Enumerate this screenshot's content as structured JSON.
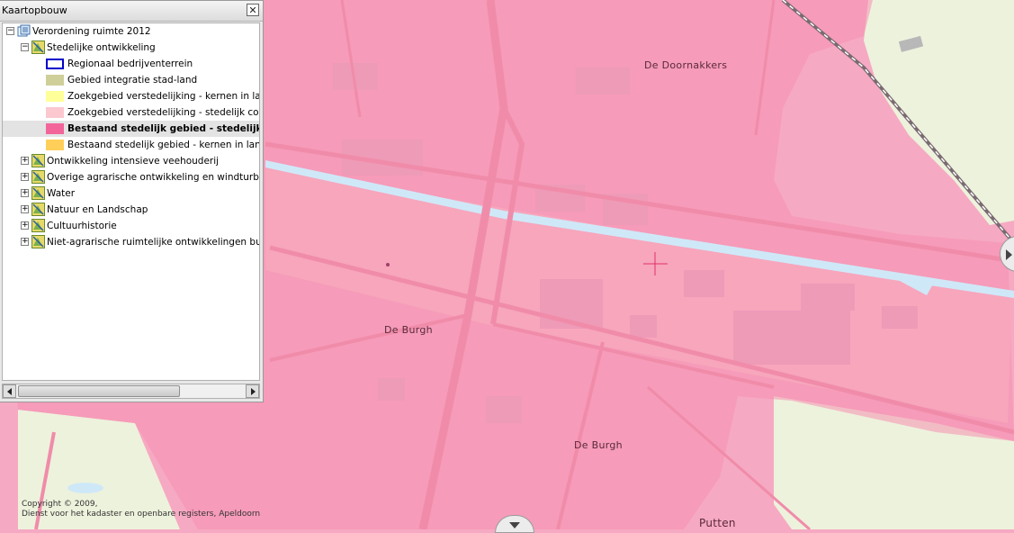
{
  "panel": {
    "title": "Kaartopbouw",
    "close_symbol": "✕",
    "root": {
      "label": "Verordening ruimte 2012",
      "toggle": "−"
    },
    "group": {
      "label": "Stedelijke ontwikkeling",
      "toggle": "−"
    },
    "legend_items": [
      {
        "label": "Regionaal bedrijventerrein",
        "fill": "#ffffff",
        "border": "#0000cc"
      },
      {
        "label": "Gebied integratie stad-land",
        "fill": "#cfcf9a",
        "border": "#cfcf9a"
      },
      {
        "label": "Zoekgebied verstedelijking - kernen in landelijk gebied",
        "fill": "#ffff99",
        "border": "#ffff99"
      },
      {
        "label": "Zoekgebied verstedelijking - stedelijk concentratiegebied",
        "fill": "#fbc8d0",
        "border": "#fbc8d0"
      },
      {
        "label": "Bestaand stedelijk gebied - stedelijk concentratiegebied",
        "fill": "#f2649a",
        "border": "#f2649a",
        "selected": true
      },
      {
        "label": "Bestaand stedelijk gebied - kernen in landelijk gebied",
        "fill": "#ffcf5a",
        "border": "#ffcf5a"
      }
    ],
    "collapsed_groups": [
      {
        "label": "Ontwikkeling intensieve veehouderij",
        "toggle": "+"
      },
      {
        "label": "Overige agrarische ontwikkeling en windturbines",
        "toggle": "+"
      },
      {
        "label": "Water",
        "toggle": "+"
      },
      {
        "label": "Natuur en Landschap",
        "toggle": "+"
      },
      {
        "label": "Cultuurhistorie",
        "toggle": "+"
      },
      {
        "label": "Niet-agrarische ruimtelijke ontwikkelingen buiten bestaand stedelijk gebied",
        "toggle": "+"
      }
    ]
  },
  "map": {
    "places": [
      "De Doornakkers",
      "De Burgh",
      "De Burgh",
      "Putten"
    ],
    "copyright": [
      "Copyright © 2009,",
      "Dienst voor het kadaster en openbare registers, Apeldoorn"
    ],
    "colors": {
      "urban": "#f6a9c2",
      "rural": "#eef3de",
      "water": "#cfe8f8",
      "road": "#f08caa",
      "building": "#ee9bb8"
    }
  }
}
